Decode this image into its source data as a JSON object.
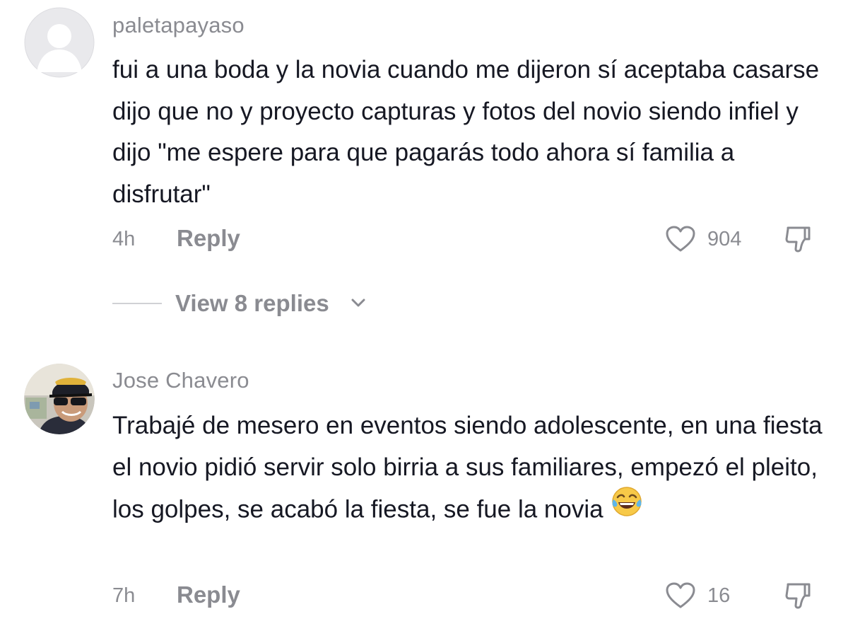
{
  "comments": [
    {
      "username": "paletapayaso",
      "avatar": "default-avatar",
      "text": "fui a una boda y la novia cuando me dijeron sí aceptaba casarse dijo que no y proyecto capturas y fotos del novio siendo infiel y dijo \"me espere para que pagarás todo ahora sí familia a disfrutar\"",
      "time": "4h",
      "reply_label": "Reply",
      "likes": "904",
      "view_replies": "View 8 replies"
    },
    {
      "username": "Jose Chavero",
      "avatar": "user-photo-avatar",
      "text": "Trabajé de mesero en eventos siendo adolescente, en una fiesta el novio pidió servir solo birria a sus familiares, empezó el pleito, los golpes, se acabó la fiesta, se fue la novia",
      "emoji": "face-with-tears-of-joy",
      "time": "7h",
      "reply_label": "Reply",
      "likes": "16"
    }
  ],
  "colors": {
    "text": "#161823",
    "secondary": "#8a8b91",
    "divider": "#d0d1d5",
    "background": "#ffffff"
  }
}
